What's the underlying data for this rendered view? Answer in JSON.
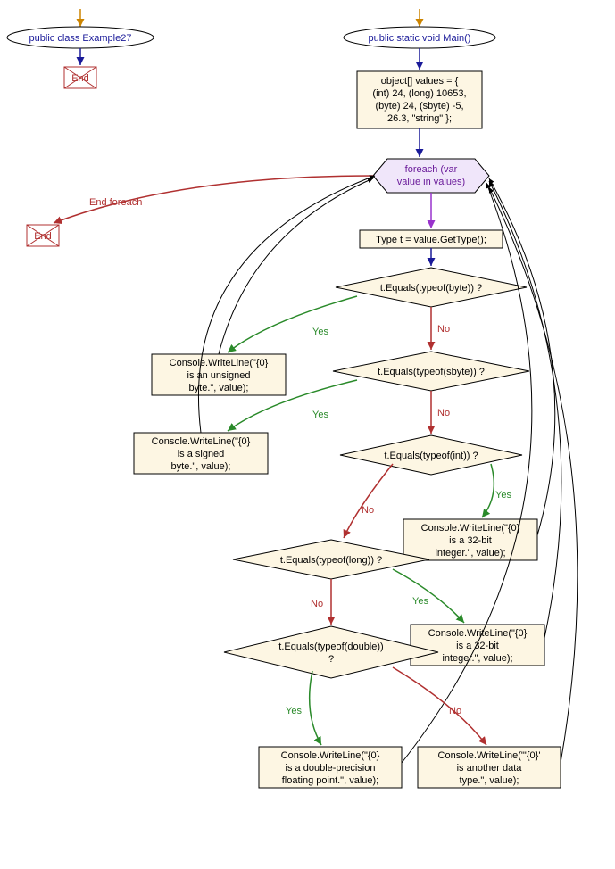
{
  "chart_data": {
    "type": "flowchart",
    "nodes": [
      {
        "id": "class",
        "shape": "ellipse",
        "label": "public class Example27"
      },
      {
        "id": "endclass",
        "shape": "endbox",
        "label": "End"
      },
      {
        "id": "main",
        "shape": "ellipse",
        "label": "public static void Main()"
      },
      {
        "id": "decl",
        "shape": "rect",
        "label": "object[] values = {\n(int) 24, (long) 10653,\n(byte) 24, (sbyte) -5,\n26.3, \"string\" };"
      },
      {
        "id": "foreach",
        "shape": "loop",
        "label": "foreach (var\nvalue in values)"
      },
      {
        "id": "endfor",
        "shape": "endbox",
        "label": "End"
      },
      {
        "id": "gettype",
        "shape": "rect",
        "label": "Type t = value.GetType();"
      },
      {
        "id": "byte",
        "shape": "diamond",
        "label": "t.Equals(typeof(byte)) ?"
      },
      {
        "id": "wbyte",
        "shape": "rect",
        "label": "Console.WriteLine(\"{0}\nis an unsigned\nbyte.\", value);"
      },
      {
        "id": "sbyte",
        "shape": "diamond",
        "label": "t.Equals(typeof(sbyte)) ?"
      },
      {
        "id": "wsbyte",
        "shape": "rect",
        "label": "Console.WriteLine(\"{0}\nis a signed\nbyte.\", value);"
      },
      {
        "id": "int",
        "shape": "diamond",
        "label": "t.Equals(typeof(int)) ?"
      },
      {
        "id": "wint",
        "shape": "rect",
        "label": "Console.WriteLine(\"{0}\nis a 32-bit\ninteger.\", value);"
      },
      {
        "id": "long",
        "shape": "diamond",
        "label": "t.Equals(typeof(long)) ?"
      },
      {
        "id": "wlong",
        "shape": "rect",
        "label": "Console.WriteLine(\"{0}\nis a 32-bit\ninteger.\", value);"
      },
      {
        "id": "double",
        "shape": "diamond",
        "label": "t.Equals(typeof(double))\n?"
      },
      {
        "id": "wdouble",
        "shape": "rect",
        "label": "Console.WriteLine(\"{0}\nis a double-precision\nfloating point.\", value);"
      },
      {
        "id": "wother",
        "shape": "rect",
        "label": "Console.WriteLine(\"'{0}'\nis another data\ntype.\", value);"
      }
    ],
    "edge_labels": {
      "endforeach": "End foreach",
      "yes": "Yes",
      "no": "No"
    }
  }
}
